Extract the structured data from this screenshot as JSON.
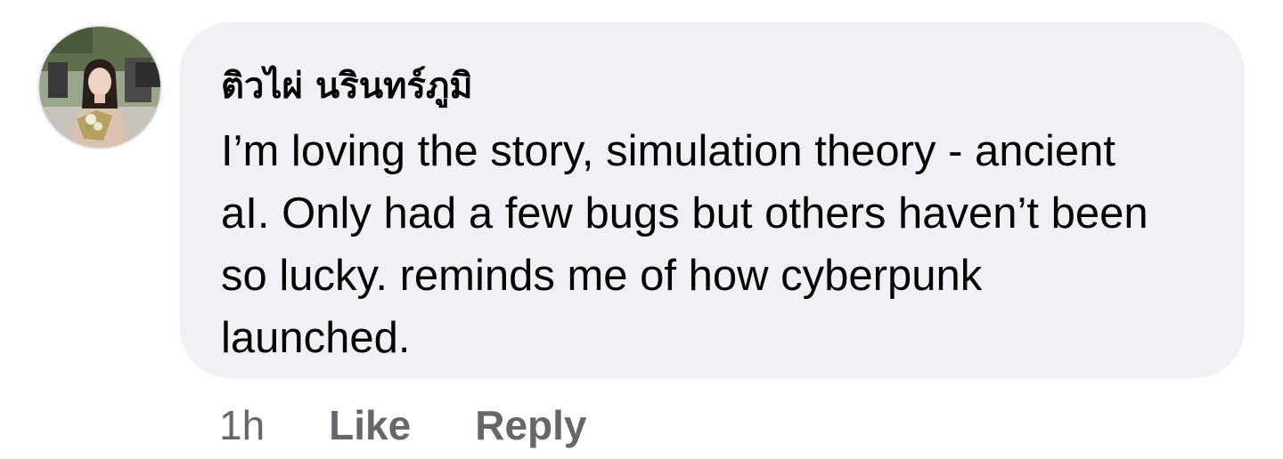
{
  "comment": {
    "author": "ติวไผ่ นรินทร์ภูมิ",
    "text": "I’m loving the story, simulation theory - ancient aI. Only had a few bugs but others haven’t been so lucky.  reminds me of how cyberpunk launched.",
    "time": "1h",
    "like_label": "Like",
    "reply_label": "Reply"
  },
  "colors": {
    "bubble_background": "#f0f1f4",
    "primary_text": "#050505",
    "secondary_text": "#65676b"
  },
  "icons": {
    "avatar": "profile-photo"
  }
}
